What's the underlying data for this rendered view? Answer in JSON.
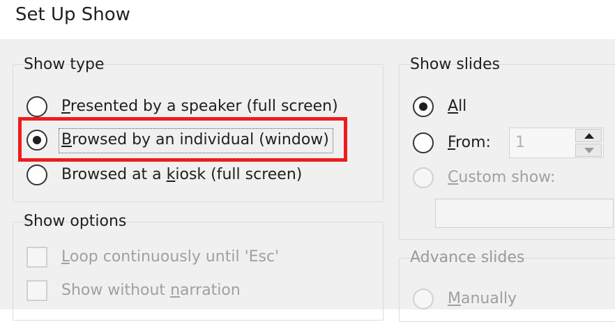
{
  "window": {
    "title": "Set Up Show"
  },
  "show_type": {
    "label": "Show type",
    "options": [
      {
        "pre": "",
        "key": "P",
        "post": "resented by a speaker (full screen)",
        "selected": false
      },
      {
        "pre": "",
        "key": "B",
        "post": "rowsed by an individual (window)",
        "selected": true
      },
      {
        "pre": "Browsed at a ",
        "key": "k",
        "post": "iosk (full screen)",
        "selected": false
      }
    ]
  },
  "show_options": {
    "label": "Show options",
    "items": [
      {
        "pre": "",
        "key": "L",
        "post": "oop continuously until 'Esc'",
        "checked": false,
        "enabled": false
      },
      {
        "pre": "Show without ",
        "key": "n",
        "post": "arration",
        "checked": false,
        "enabled": false
      }
    ]
  },
  "show_slides": {
    "label": "Show slides",
    "all": {
      "pre": "",
      "key": "A",
      "post": "ll",
      "selected": true
    },
    "from": {
      "pre": "",
      "key": "F",
      "post": "rom:",
      "value": "1",
      "selected": false
    },
    "custom": {
      "pre": "",
      "key": "C",
      "post": "ustom show:",
      "enabled": false
    },
    "custom_value": ""
  },
  "advance_slides": {
    "label": "Advance slides",
    "manually": {
      "pre": "",
      "key": "M",
      "post": "anually",
      "enabled": false
    }
  },
  "highlight_color": "#ee1c1c"
}
